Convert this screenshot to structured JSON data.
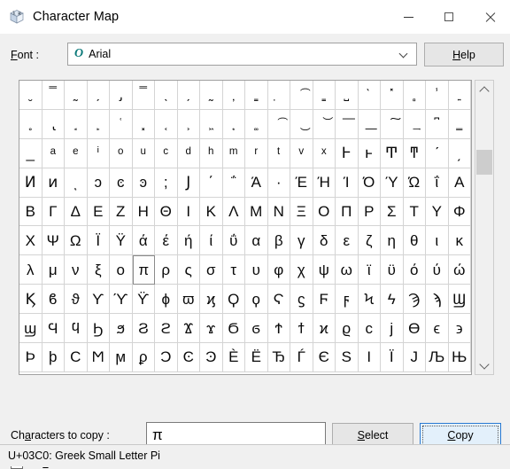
{
  "window": {
    "title": "Character Map",
    "icon": "character-map-icon",
    "minimize_label": "Minimize",
    "maximize_label": "Maximize",
    "close_label": "Close"
  },
  "font": {
    "label": "Font :",
    "label_accel": "F",
    "selected": "Arial",
    "type_icon": "O",
    "dropdown_icon": "chevron-down-icon"
  },
  "help": {
    "label": "Help",
    "accel": "H"
  },
  "grid": {
    "columns": 20,
    "selected_index": 125,
    "rows": [
      [
        "̮",
        "̿",
        "̰",
        "̗",
        "̡",
        "̿",
        "̖",
        "̗",
        "̰",
        "̦",
        "̳",
        "̣",
        "͡",
        "̳",
        "̺",
        "̀",
        "̽",
        "̻",
        "̾",
        "͍"
      ],
      [
        "̥",
        "̢",
        "̘",
        "̙",
        "͑",
        "͓",
        "͔",
        "͕",
        "͖",
        "͙",
        "͚",
        "͡",
        "͜",
        "͝",
        "͞",
        "͟",
        "͠",
        "͢",
        "͆",
        "͇"
      ],
      [
        "̲",
        "ᵃ",
        "ᵉ",
        "ⁱ",
        "ᵒ",
        "ᵘ",
        "ᶜ",
        "ᵈ",
        "ʰ",
        "ᵐ",
        "ʳ",
        "ᵗ",
        "ᵛ",
        "ˣ",
        "Ͱ",
        "ͱ",
        "Ͳ",
        "ͳ",
        "ʹ",
        "͵"
      ],
      [
        "Ͷ",
        "ͷ",
        "ͺ",
        "ͻ",
        "ͼ",
        "ͽ",
        ";",
        "Ϳ",
        "΄",
        "΅",
        "Ά",
        "·",
        "Έ",
        "Ή",
        "Ί",
        "Ό",
        "Ύ",
        "Ώ",
        "ΐ",
        "Α"
      ],
      [
        "Β",
        "Γ",
        "Δ",
        "Ε",
        "Ζ",
        "Η",
        "Θ",
        "Ι",
        "Κ",
        "Λ",
        "Μ",
        "Ν",
        "Ξ",
        "Ο",
        "Π",
        "Ρ",
        "Σ",
        "Τ",
        "Υ",
        "Φ"
      ],
      [
        "Χ",
        "Ψ",
        "Ω",
        "Ϊ",
        "Ϋ",
        "ά",
        "έ",
        "ή",
        "ί",
        "ΰ",
        "α",
        "β",
        "γ",
        "δ",
        "ε",
        "ζ",
        "η",
        "θ",
        "ι",
        "κ"
      ],
      [
        "λ",
        "μ",
        "ν",
        "ξ",
        "ο",
        "π",
        "ρ",
        "ς",
        "σ",
        "τ",
        "υ",
        "φ",
        "χ",
        "ψ",
        "ω",
        "ϊ",
        "ϋ",
        "ό",
        "ύ",
        "ώ"
      ],
      [
        "Ϗ",
        "ϐ",
        "ϑ",
        "ϒ",
        "ϓ",
        "ϔ",
        "ϕ",
        "ϖ",
        "ϗ",
        "Ϙ",
        "ϙ",
        "Ϛ",
        "ϛ",
        "Ϝ",
        "ϝ",
        "Ϟ",
        "ϟ",
        "Ϡ",
        "ϡ",
        "Ϣ"
      ],
      [
        "ϣ",
        "Ϥ",
        "ϥ",
        "Ϧ",
        "ϧ",
        "Ϩ",
        "ϩ",
        "Ϫ",
        "ϫ",
        "Ϭ",
        "ϭ",
        "Ϯ",
        "ϯ",
        "ϰ",
        "ϱ",
        "ϲ",
        "ϳ",
        "ϴ",
        "ϵ",
        "϶"
      ],
      [
        "Ϸ",
        "ϸ",
        "Ϲ",
        "Ϻ",
        "ϻ",
        "ϼ",
        "Ͻ",
        "Ͼ",
        "Ͽ",
        "Ѐ",
        "Ё",
        "Ђ",
        "Ѓ",
        "Є",
        "Ѕ",
        "І",
        "Ї",
        "Ј",
        "Љ",
        "Њ"
      ]
    ]
  },
  "scrollbar": {
    "up_icon": "chevron-up-icon",
    "down_icon": "chevron-down-icon",
    "thumb": "scroll-thumb"
  },
  "copy": {
    "label": "Characters to copy :",
    "label_accel": "a",
    "value": "π",
    "placeholder": ""
  },
  "buttons": {
    "select": {
      "label": "Select",
      "accel": "S"
    },
    "copy": {
      "label": "Copy",
      "accel": "C",
      "focused": true
    }
  },
  "advanced": {
    "label": "Advanced view",
    "accel": "v",
    "checked": false
  },
  "status": {
    "text": "U+03C0: Greek Small Letter Pi"
  }
}
